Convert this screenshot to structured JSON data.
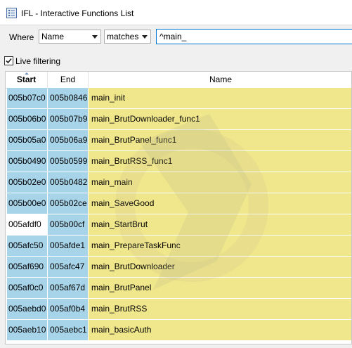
{
  "window": {
    "title": "IFL - Interactive Functions List",
    "icon": "list-window-icon"
  },
  "filter": {
    "where_label": "Where",
    "field_value": "Name",
    "operator_value": "matches",
    "pattern_value": "^main_",
    "live_filtering_label": "Live filtering",
    "live_filtering_checked": true
  },
  "table": {
    "columns": [
      "Start",
      "End",
      "Name"
    ],
    "sorted_column": "Start",
    "rows": [
      {
        "start": "005b07c0",
        "end": "005b0846",
        "name": "main_init",
        "start_highlight": true
      },
      {
        "start": "005b06b0",
        "end": "005b07b9",
        "name": "main_BrutDownloader_func1",
        "start_highlight": true
      },
      {
        "start": "005b05a0",
        "end": "005b06a9",
        "name": "main_BrutPanel_func1",
        "start_highlight": true
      },
      {
        "start": "005b0490",
        "end": "005b0599",
        "name": "main_BrutRSS_func1",
        "start_highlight": true
      },
      {
        "start": "005b02e0",
        "end": "005b0482",
        "name": "main_main",
        "start_highlight": true
      },
      {
        "start": "005b00e0",
        "end": "005b02ce",
        "name": "main_SaveGood",
        "start_highlight": true
      },
      {
        "start": "005afdf0",
        "end": "005b00cf",
        "name": "main_StartBrut",
        "start_highlight": false
      },
      {
        "start": "005afc50",
        "end": "005afde1",
        "name": "main_PrepareTaskFunc",
        "start_highlight": true
      },
      {
        "start": "005af690",
        "end": "005afc47",
        "name": "main_BrutDownloader",
        "start_highlight": true
      },
      {
        "start": "005af0c0",
        "end": "005af67d",
        "name": "main_BrutPanel",
        "start_highlight": true
      },
      {
        "start": "005aebd0",
        "end": "005af0b4",
        "name": "main_BrutRSS",
        "start_highlight": true
      },
      {
        "start": "005aeb10",
        "end": "005aebc1",
        "name": "main_basicAuth",
        "start_highlight": true
      }
    ]
  },
  "colors": {
    "address_bg": "#a8d4ea",
    "name_bg": "#f0e68c",
    "selected_bg": "#ffffff",
    "input_border": "#0078d7"
  }
}
